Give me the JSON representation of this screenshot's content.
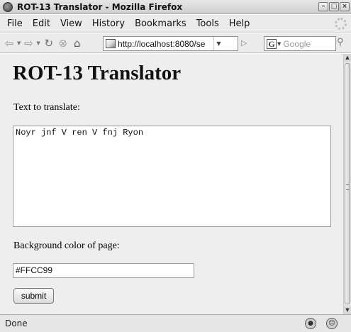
{
  "window": {
    "title": "ROT-13 Translator - Mozilla Firefox"
  },
  "menu": {
    "items": [
      "File",
      "Edit",
      "View",
      "History",
      "Bookmarks",
      "Tools",
      "Help"
    ]
  },
  "nav": {
    "url": "http://localhost:8080/se",
    "search_placeholder": "Google",
    "icons": [
      "back-arrow-icon",
      "forward-arrow-icon",
      "reload-icon",
      "stop-icon",
      "home-icon",
      "go-icon",
      "search-magnifier-icon"
    ]
  },
  "page": {
    "heading": "ROT-13 Translator",
    "text_label": "Text to translate:",
    "text_value": "Noyr jnf V ren V fnj Ryon",
    "bg_label": "Background color of page:",
    "bg_value": "#FFCC99",
    "submit_label": "submit",
    "background_color": "#eeeeee"
  },
  "status": {
    "text": "Done"
  }
}
